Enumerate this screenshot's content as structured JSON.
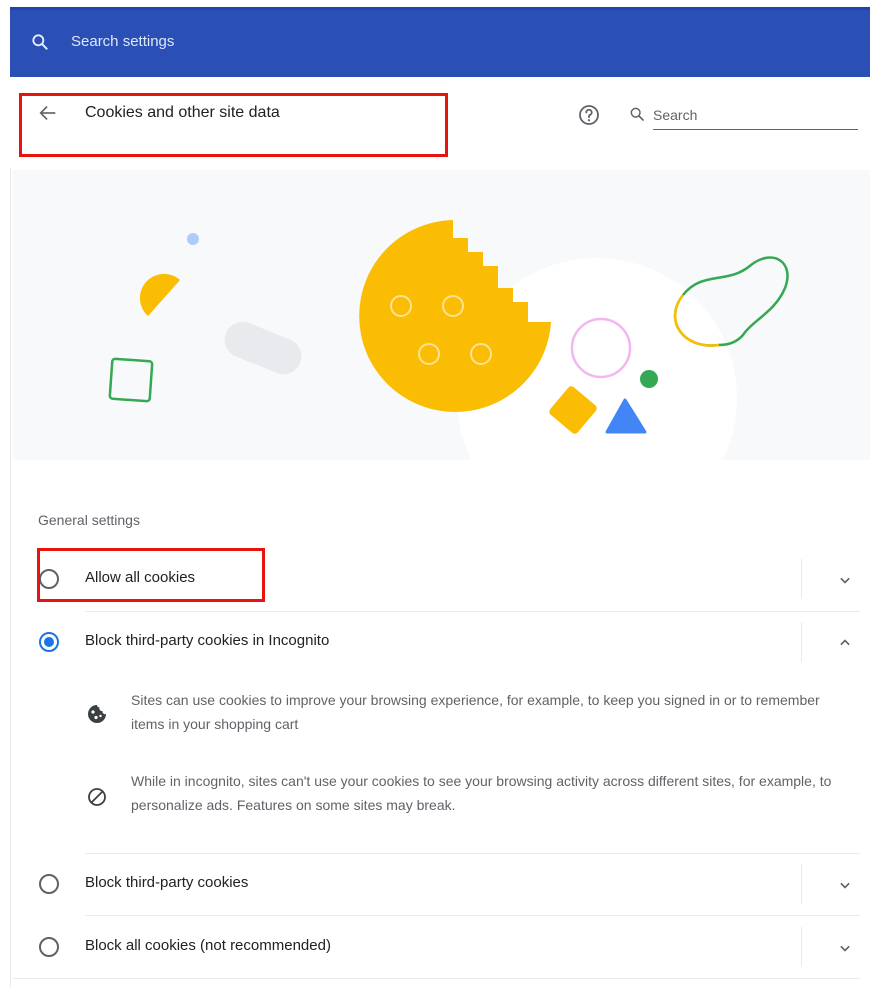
{
  "topbar": {
    "search_placeholder": "Search settings"
  },
  "header": {
    "title": "Cookies and other site data",
    "help_icon": "help-circle-icon",
    "search_placeholder": "Search"
  },
  "general_settings": {
    "title": "General settings",
    "options": [
      {
        "label": "Allow all cookies",
        "selected": false,
        "expanded": false
      },
      {
        "label": "Block third-party cookies in Incognito",
        "selected": true,
        "expanded": true
      },
      {
        "label": "Block third-party cookies",
        "selected": false,
        "expanded": false
      },
      {
        "label": "Block all cookies (not recommended)",
        "selected": false,
        "expanded": false
      }
    ],
    "details": [
      {
        "icon": "cookie-icon",
        "text": "Sites can use cookies to improve your browsing experience, for example, to keep you signed in or to remember items in your shopping cart"
      },
      {
        "icon": "block-icon",
        "text": "While in incognito, sites can't use your cookies to see your browsing activity across different sites, for example, to personalize ads. Features on some sites may break."
      }
    ]
  },
  "colors": {
    "topbar": "#2a50b5",
    "accent": "#1a73e8",
    "highlight": "#e8130f",
    "cookie": "#fbbc04",
    "green": "#34a853"
  }
}
